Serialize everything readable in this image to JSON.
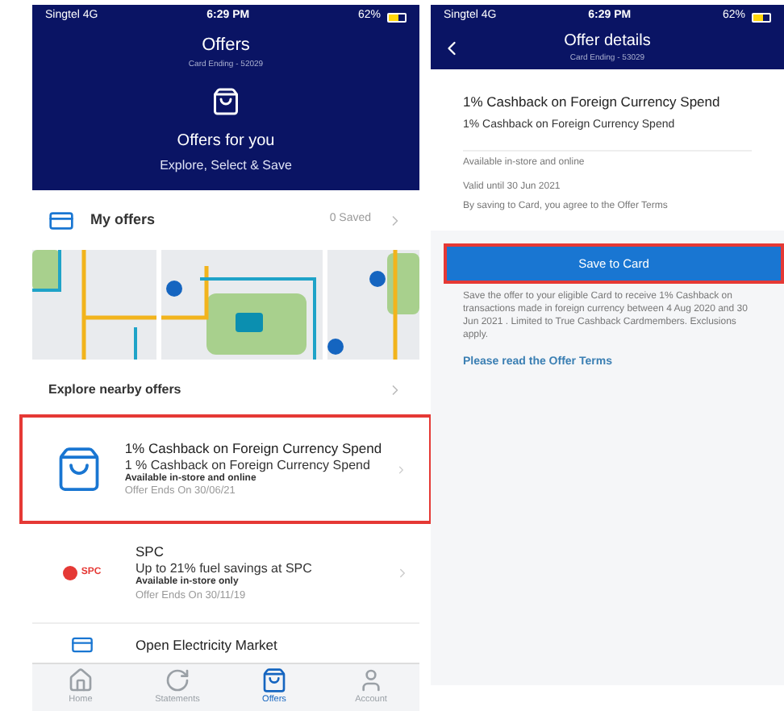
{
  "left": {
    "status_bar": {
      "carrier": "Singtel",
      "network": "4G",
      "time": "6:29 PM",
      "battery": "62%"
    },
    "header": {
      "title": "Offers",
      "subtitle": "Card Ending - 52029",
      "heading": "Offers for you",
      "tagline": "Explore, Select & Save"
    },
    "my_offers": {
      "label": "My offers",
      "count": "0 Saved"
    },
    "explore": {
      "label": "Explore nearby offers"
    },
    "offers": [
      {
        "kind": "bag",
        "highlighted": true,
        "title": "1% Cashback on Foreign Currency Spend",
        "subtitle": "1 % Cashback on Foreign Currency Spend",
        "availability": "Available in-store and online",
        "ends": "Offer Ends On 30/06/21"
      },
      {
        "kind": "spc",
        "highlighted": false,
        "logo": "SPC",
        "title": "SPC",
        "subtitle": "Up to 21% fuel savings at SPC",
        "availability": "Available in-store only",
        "ends": "Offer Ends On 30/11/19"
      },
      {
        "kind": "card",
        "highlighted": false,
        "title": "Open Electricity Market"
      }
    ],
    "tab_bar": [
      {
        "label": "Home",
        "selected": false
      },
      {
        "label": "Statements",
        "selected": false
      },
      {
        "label": "Offers",
        "selected": true
      },
      {
        "label": "Account",
        "selected": false
      }
    ]
  },
  "right": {
    "status_bar": {
      "carrier": "Singtel",
      "network": "4G",
      "time": "6:29 PM",
      "battery": "62%"
    },
    "header": {
      "title": "Offer details",
      "subtitle": "Card Ending - 53029"
    },
    "title": "1% Cashback on Foreign Currency Spend",
    "subtitle": "1% Cashback on Foreign Currency Spend",
    "details": [
      "Available in-store and online",
      "Valid until 30 Jun 2021",
      "By saving to Card, you agree to the Offer Terms"
    ],
    "button": {
      "label": "Save to Card",
      "highlighted": true
    },
    "description": "Save the offer to your eligible Card to receive 1% Cashback on transactions made in foreign currency between 4 Aug 2020 and  30 Jun 2021 . Limited to True Cashback Cardmembers. Exclusions apply.",
    "link": "Please read the Offer Terms"
  }
}
